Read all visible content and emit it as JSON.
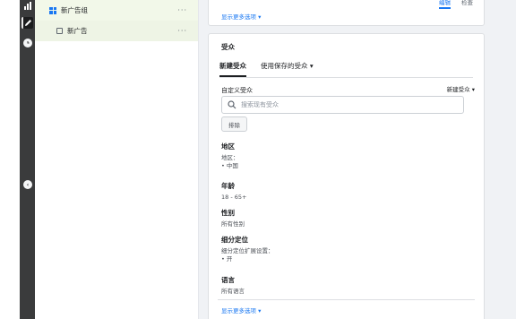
{
  "rail": {
    "icons": [
      "bar-chart-icon",
      "pencil-icon",
      "clock-icon",
      "collapse-icon"
    ]
  },
  "tree": {
    "ad_group": "新广告组",
    "ad": "新广告",
    "more": "···"
  },
  "top_card": {
    "more_options": "显示更多选项 ▾",
    "tabs": [
      "编辑",
      "检查"
    ]
  },
  "audience": {
    "title": "受众",
    "tabs": [
      "新建受众",
      "使用保存的受众 ▾"
    ],
    "custom_audience_label": "自定义受众",
    "new_audience_dropdown": "新建受众 ▾",
    "search_placeholder": "搜索现有受众",
    "exclude_button": "排除",
    "location": {
      "title": "地区",
      "label": "地区：",
      "value": "• 中国"
    },
    "age": {
      "title": "年龄",
      "value": "18 - 65+"
    },
    "gender": {
      "title": "性别",
      "value": "所有性别"
    },
    "detailed": {
      "title": "细分定位",
      "label": "细分定位扩展设置：",
      "value": "• 开"
    },
    "language": {
      "title": "语言",
      "value": "所有语言"
    },
    "more_options": "显示更多选项 ▾"
  }
}
